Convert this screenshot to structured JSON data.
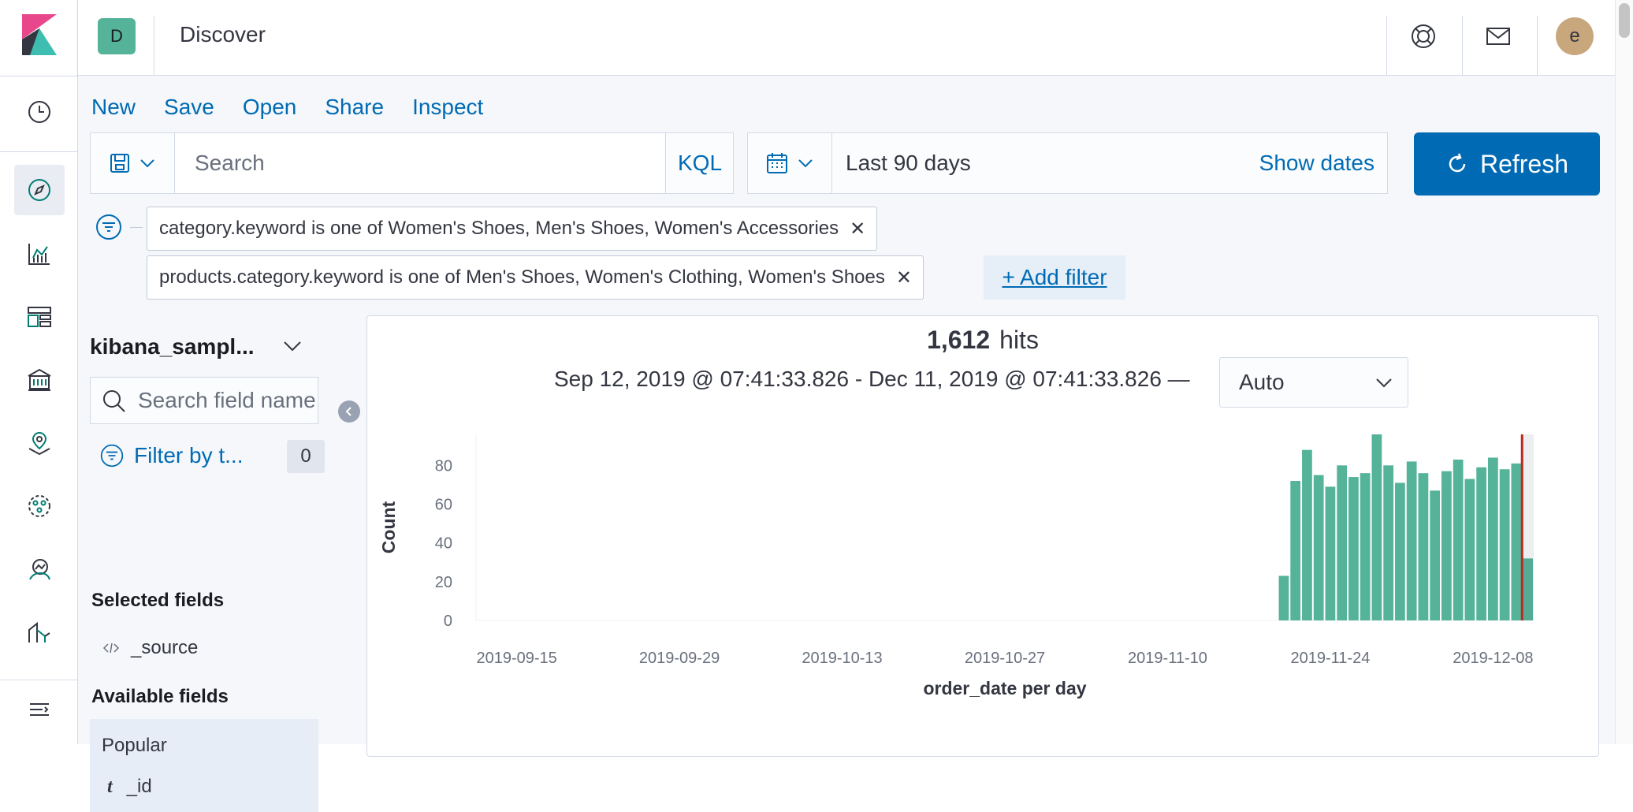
{
  "header": {
    "space_initial": "D",
    "title": "Discover",
    "avatar_initial": "e"
  },
  "topmenu": [
    "New",
    "Save",
    "Open",
    "Share",
    "Inspect"
  ],
  "query": {
    "placeholder": "Search",
    "language": "KQL"
  },
  "date": {
    "range": "Last 90 days",
    "show_dates": "Show dates"
  },
  "refresh_label": "Refresh",
  "filters": [
    "category.keyword is one of Women's Shoes, Men's Shoes, Women's Accessories",
    "products.category.keyword is one of Men's Shoes, Women's Clothing, Women's Shoes"
  ],
  "add_filter_label": "+ Add filter",
  "sidebar": {
    "index_pattern": "kibana_sampl...",
    "field_search_placeholder": "Search field names",
    "filter_by_type": "Filter by t...",
    "filter_count": "0",
    "selected_heading": "Selected fields",
    "selected_fields": [
      "_source"
    ],
    "available_heading": "Available fields",
    "popular_label": "Popular",
    "popular_fields": [
      {
        "type": "t",
        "name": "_id"
      }
    ]
  },
  "results": {
    "hits_count": "1,612",
    "hits_label": "hits",
    "time_range": "Sep 12, 2019 @ 07:41:33.826 - Dec 11, 2019 @ 07:41:33.826 —",
    "interval": "Auto"
  },
  "colors": {
    "bar": "#54b399",
    "current_time_marker": "#bd271e",
    "link": "#006bb4"
  },
  "chart_data": {
    "type": "bar",
    "xlabel": "order_date per day",
    "ylabel": "Count",
    "ylim": [
      0,
      96
    ],
    "yticks": [
      0,
      20,
      40,
      60,
      80
    ],
    "xtick_labels": [
      "2019-09-15",
      "2019-09-29",
      "2019-10-13",
      "2019-10-27",
      "2019-11-10",
      "2019-11-24",
      "2019-12-08"
    ],
    "x_range": [
      "2019-09-12",
      "2019-12-11"
    ],
    "x": [
      "2019-11-20",
      "2019-11-21",
      "2019-11-22",
      "2019-11-23",
      "2019-11-24",
      "2019-11-25",
      "2019-11-26",
      "2019-11-27",
      "2019-11-28",
      "2019-11-29",
      "2019-11-30",
      "2019-12-01",
      "2019-12-02",
      "2019-12-03",
      "2019-12-04",
      "2019-12-05",
      "2019-12-06",
      "2019-12-07",
      "2019-12-08",
      "2019-12-09",
      "2019-12-10",
      "2019-12-11"
    ],
    "values": [
      23,
      72,
      88,
      75,
      69,
      80,
      74,
      76,
      96,
      80,
      71,
      82,
      76,
      67,
      77,
      83,
      73,
      79,
      84,
      78,
      81,
      32
    ],
    "current_time": "2019-12-11",
    "grid": false,
    "legend": "none"
  }
}
